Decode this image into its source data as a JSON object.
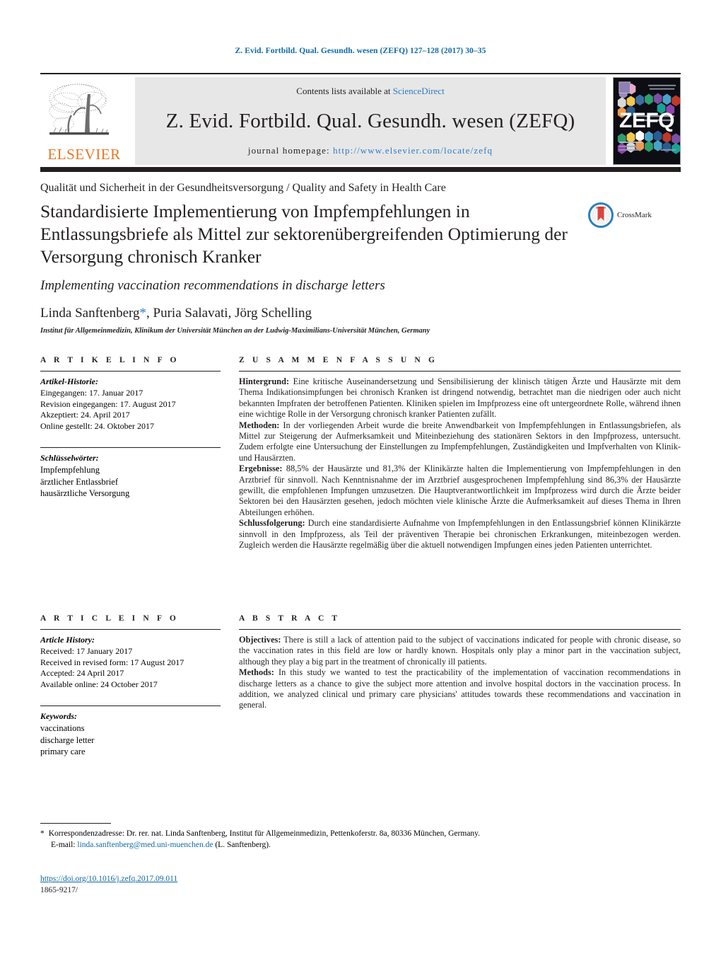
{
  "running_head": "Z. Evid. Fortbild. Qual. Gesundh. wesen (ZEFQ) 127–128 (2017) 30–35",
  "masthead": {
    "contents_prefix": "Contents lists available at ",
    "contents_link": "ScienceDirect",
    "journal_title": "Z. Evid. Fortbild. Qual. Gesundh. wesen (ZEFQ)",
    "homepage_prefix": "journal homepage: ",
    "homepage_url": "http://www.elsevier.com/locate/zefq",
    "publisher": "ELSEVIER",
    "cover_label": "ZEFQ"
  },
  "section_kicker": "Qualität und Sicherheit in der Gesundheitsversorgung / Quality and Safety in Health Care",
  "title": "Standardisierte Implementierung von Impfempfehlungen in Entlassungsbriefe als Mittel zur sektorenübergreifenden Optimierung der Versorgung chronisch Kranker",
  "subtitle": "Implementing vaccination recommendations in discharge letters",
  "authors": "Linda Sanftenberg",
  "authors_rest": ", Puria Salavati, Jörg Schelling",
  "author_marker": "*",
  "affiliation": "Institut für Allgemeinmedizin, Klinikum der Universität München an der Ludwig-Maximilians-Universität München, Germany",
  "crossmark_label": "CrossMark",
  "german_info": {
    "heading": "A R T I K E L   I N F O",
    "history_label": "Artikel-Historie:",
    "history": [
      "Eingegangen: 17. Januar 2017",
      "Revision eingegangen: 17. August 2017",
      "Akzeptiert: 24. April 2017",
      "Online gestellt: 24. Oktober 2017"
    ],
    "keywords_label": "Schlüsselwörter:",
    "keywords": [
      "Impfempfehlung",
      "ärztlicher Entlassbrief",
      "hausärztliche Versorgung"
    ]
  },
  "german_abstract": {
    "heading": "Z U S A M M E N F A S S U N G",
    "paragraphs": [
      {
        "label": "Hintergrund:",
        "text": " Eine kritische Auseinandersetzung und Sensibilisierung der klinisch tätigen Ärzte und Hausärzte mit dem Thema Indikationsimpfungen bei chronisch Kranken ist dringend notwendig, betrachtet man die niedrigen oder auch nicht bekannten Impfraten der betroffenen Patienten. Kliniken spielen im Impfprozess eine oft untergeordnete Rolle, während ihnen eine wichtige Rolle in der Versorgung chronisch kranker Patienten zufällt."
      },
      {
        "label": "Methoden:",
        "text": " In der vorliegenden Arbeit wurde die breite Anwendbarkeit von Impfempfehlungen in Entlassungsbriefen, als Mittel zur Steigerung der Aufmerksamkeit und Miteinbeziehung des stationären Sektors in den Impfprozess, untersucht. Zudem erfolgte eine Untersuchung der Einstellungen zu Impfempfehlungen, Zuständigkeiten und Impfverhalten von Klinik- und Hausärzten."
      },
      {
        "label": "Ergebnisse:",
        "text": " 88,5% der Hausärzte und 81,3% der Klinikärzte halten die Implementierung von Impfempfehlungen in den Arztbrief für sinnvoll. Nach Kenntnisnahme der im Arztbrief ausgesprochenen Impfempfehlung sind 86,3% der Hausärzte gewillt, die empfohlenen Impfungen umzusetzen. Die Hauptverantwortlichkeit im Impfprozess wird durch die Ärzte beider Sektoren bei den Hausärzten gesehen, jedoch möchten viele klinische Ärzte die Aufmerksamkeit auf dieses Thema in Ihren Abteilungen erhöhen."
      },
      {
        "label": "Schlussfolgerung:",
        "text": " Durch eine standardisierte Aufnahme von Impfempfehlungen in den Entlassungsbrief können Klinikärzte sinnvoll in den Impfprozess, als Teil der präventiven Therapie bei chronischen Erkrankungen, miteinbezogen werden. Zugleich werden die Hausärzte regelmäßig über die aktuell notwendigen Impfungen eines jeden Patienten unterrichtet."
      }
    ]
  },
  "english_info": {
    "heading": "A R T I C L E   I N F O",
    "history_label": "Article History:",
    "history": [
      "Received: 17 January 2017",
      "Received in revised form: 17 August 2017",
      "Accepted: 24 April 2017",
      "Available online: 24 October 2017"
    ],
    "keywords_label": "Keywords:",
    "keywords": [
      "vaccinations",
      "discharge letter",
      "primary care"
    ]
  },
  "english_abstract": {
    "heading": "A B S T R A C T",
    "paragraphs": [
      {
        "label": "Objectives:",
        "text": " There is still a lack of attention paid to the subject of vaccinations indicated for people with chronic disease, so the vaccination rates in this field are low or hardly known. Hospitals only play a minor part in the vaccination subject, although they play a big part in the treatment of chronically ill patients."
      },
      {
        "label": "Methods:",
        "text": " In this study we wanted to test the practicability of the implementation of vaccination recommendations in discharge letters as a chance to give the subject more attention and involve hospital doctors in the vaccination process. In addition, we analyzed clinical und primary care physicians' attitudes towards these recommendations and vaccination in general."
      }
    ]
  },
  "footnote": {
    "marker": "*",
    "line1": "Korrespondenzadresse: Dr. rer. nat. Linda Sanftenberg, Institut für Allgemeinmedizin, Pettenkoferstr. 8a, 80336 München, Germany.",
    "email_prefix": "E-mail: ",
    "email": "linda.sanftenberg@med.uni-muenchen.de",
    "email_suffix": " (L. Sanftenberg)."
  },
  "doi": "https://doi.org/10.1016/j.zefq.2017.09.011",
  "issn": "1865-9217/",
  "colors": {
    "link": "#1069a4",
    "elsevier_orange": "#e87722",
    "band_gray": "#e7e7e7",
    "rule_dark": "#231f20"
  }
}
